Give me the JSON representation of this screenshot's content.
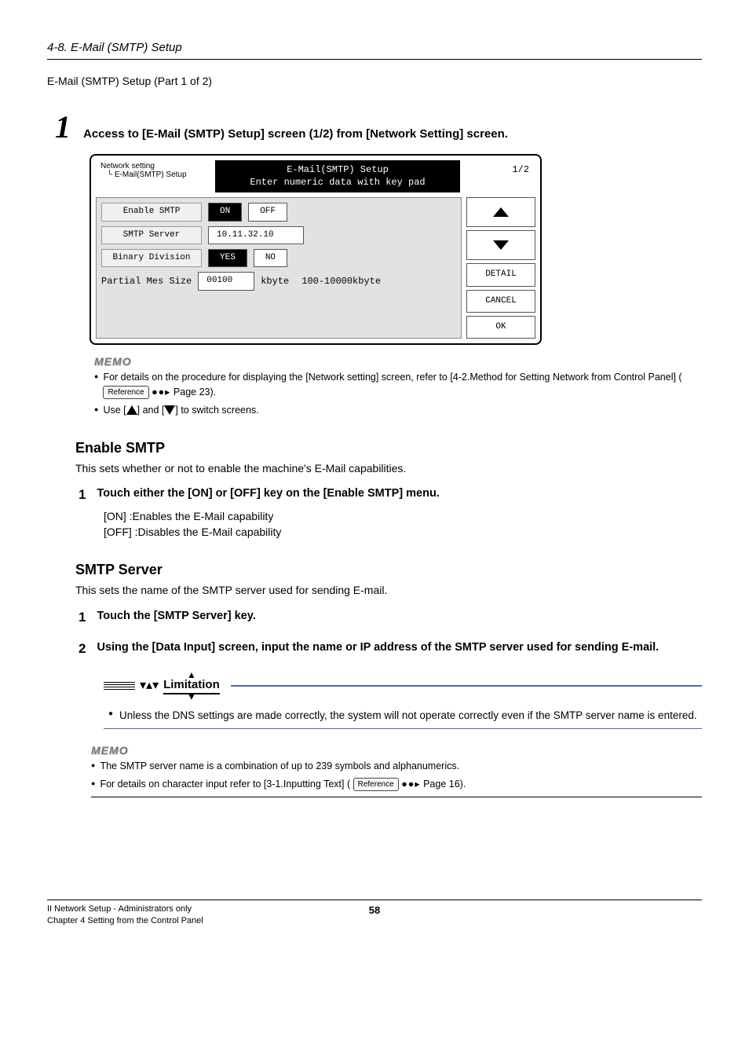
{
  "header": {
    "section_title": "4-8. E-Mail (SMTP) Setup",
    "part_label": "E-Mail (SMTP) Setup (Part 1 of 2)"
  },
  "step1": {
    "number": "1",
    "text": "Access to [E-Mail (SMTP) Setup] screen (1/2) from [Network Setting] screen."
  },
  "panel": {
    "breadcrumb1": "Network setting",
    "breadcrumb2": "E-Mail(SMTP) Setup",
    "title_line1": "E-Mail(SMTP) Setup",
    "title_line2": "Enter numeric data with key pad",
    "page": "1/2",
    "row1_label": "Enable SMTP",
    "row1_on": "ON",
    "row1_off": "OFF",
    "row2_label": "SMTP Server",
    "row2_value": "10.11.32.10",
    "row3_label": "Binary Division",
    "row3_yes": "YES",
    "row3_no": "NO",
    "row4_label": "Partial Mes Size",
    "row4_value": "00100",
    "row4_unit": "kbyte",
    "row4_range": "100-10000kbyte",
    "side_detail": "DETAIL",
    "side_cancel": "CANCEL",
    "side_ok": "OK"
  },
  "memo1": {
    "label": "MEMO",
    "bullet1_a": "For details on the procedure for displaying the [Network setting] screen, refer to [4-2.Method for Setting Network from Control Panel] (",
    "ref": "Reference",
    "bullet1_b": " Page 23).",
    "bullet2_a": "Use [",
    "bullet2_b": "] and [",
    "bullet2_c": "] to switch screens."
  },
  "enable_smtp": {
    "title": "Enable SMTP",
    "desc": "This sets whether or not to enable the machine's E-Mail capabilities.",
    "step_num": "1",
    "step_text": "Touch either the [ON] or [OFF] key on the [Enable SMTP] menu.",
    "opt_on": "[ON]   :Enables the E-Mail capability",
    "opt_off": "[OFF] :Disables the E-Mail capability"
  },
  "smtp_server": {
    "title": "SMTP Server",
    "desc": "This sets the name of the SMTP server used for sending E-mail.",
    "step1_num": "1",
    "step1_text": "Touch the [SMTP Server] key.",
    "step2_num": "2",
    "step2_text": "Using the [Data Input] screen, input the name or IP address of the SMTP server used for sending E-mail."
  },
  "limitation": {
    "title": "Limitation",
    "text": "Unless the DNS settings are made correctly, the system will not operate correctly even if the SMTP server name is entered."
  },
  "memo2": {
    "label": "MEMO",
    "bullet1": "The SMTP server name is a combination of up to 239 symbols and alphanumerics.",
    "bullet2_a": "For details on character input refer to [3-1.Inputting Text] (",
    "ref": "Reference",
    "bullet2_b": " Page 16)."
  },
  "footer": {
    "left1": "II Network Setup - Administrators only",
    "left2": "Chapter 4 Setting from the Control Panel",
    "center": "58"
  }
}
